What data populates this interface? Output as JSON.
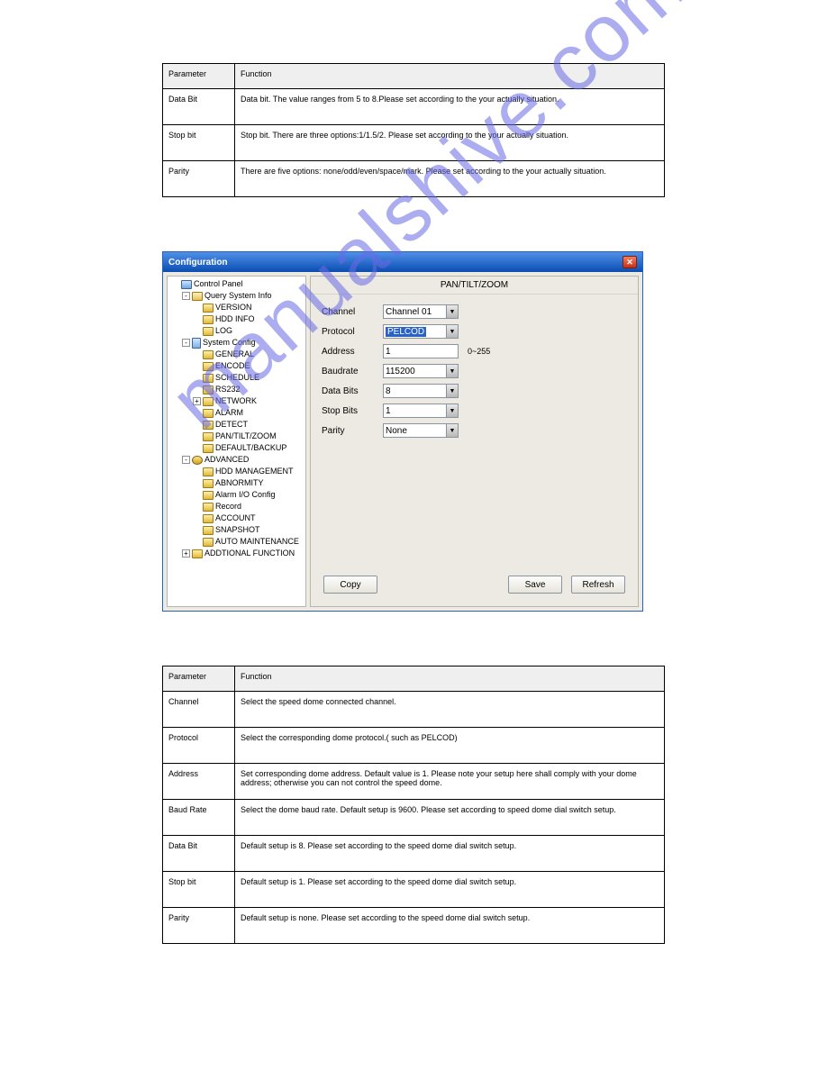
{
  "watermark": "manualshive.com",
  "table1": {
    "headers": [
      "Parameter",
      "Function"
    ],
    "rows": [
      [
        "Data Bit",
        "Data bit. The value ranges from 5 to 8.Please set according to the your actually situation."
      ],
      [
        "Stop bit",
        "Stop bit. There are three options:1/1.5/2. Please set according to the your actually situation."
      ],
      [
        "Parity",
        "There are five options: none/odd/even/space/mark. Please set according to the your actually situation."
      ]
    ]
  },
  "dialog": {
    "title": "Configuration",
    "tree": {
      "root": "Control Panel",
      "groups": [
        {
          "label": "Query System Info",
          "expanded": true,
          "icon": "edit",
          "children": [
            "VERSION",
            "HDD INFO",
            "LOG"
          ]
        },
        {
          "label": "System Config",
          "expanded": true,
          "icon": "sys",
          "children": [
            "GENERAL",
            "ENCODE",
            "SCHEDULE",
            "RS232",
            "NETWORK",
            "ALARM",
            "DETECT",
            "PAN/TILT/ZOOM",
            "DEFAULT/BACKUP"
          ],
          "expandable_children": [
            "NETWORK"
          ]
        },
        {
          "label": "ADVANCED",
          "expanded": true,
          "icon": "gear",
          "children": [
            "HDD MANAGEMENT",
            "ABNORMITY",
            "Alarm I/O Config",
            "Record",
            "ACCOUNT",
            "SNAPSHOT",
            "AUTO MAINTENANCE"
          ]
        },
        {
          "label": "ADDTIONAL FUNCTION",
          "expanded": false,
          "icon": "folder",
          "children": []
        }
      ]
    },
    "panel_title": "PAN/TILT/ZOOM",
    "form": {
      "channel": {
        "label": "Channel",
        "value": "Channel 01"
      },
      "protocol": {
        "label": "Protocol",
        "value": "PELCOD"
      },
      "address": {
        "label": "Address",
        "value": "1",
        "hint": "0~255"
      },
      "baudrate": {
        "label": "Baudrate",
        "value": "115200"
      },
      "databits": {
        "label": "Data Bits",
        "value": "8"
      },
      "stopbits": {
        "label": "Stop Bits",
        "value": "1"
      },
      "parity": {
        "label": "Parity",
        "value": "None"
      }
    },
    "buttons": {
      "copy": "Copy",
      "save": "Save",
      "refresh": "Refresh"
    }
  },
  "table2": {
    "headers": [
      "Parameter",
      "Function"
    ],
    "rows": [
      [
        "Channel",
        "Select the speed dome connected channel."
      ],
      [
        "Protocol",
        "Select the corresponding dome protocol.( such as PELCOD)"
      ],
      [
        "Address",
        "Set corresponding dome address. Default value is 1. Please note your setup here shall comply with your dome address; otherwise you can not control the speed dome."
      ],
      [
        "Baud Rate",
        "Select the dome baud rate. Default setup is 9600. Please set according to  speed dome dial switch setup."
      ],
      [
        "Data Bit",
        "Default setup is 8. Please set according to the speed dome dial switch setup."
      ],
      [
        "Stop bit",
        "Default setup is 1. Please set according to the speed dome dial switch setup."
      ],
      [
        "Parity",
        "Default setup is none. Please set according to the speed dome dial switch setup."
      ]
    ]
  }
}
